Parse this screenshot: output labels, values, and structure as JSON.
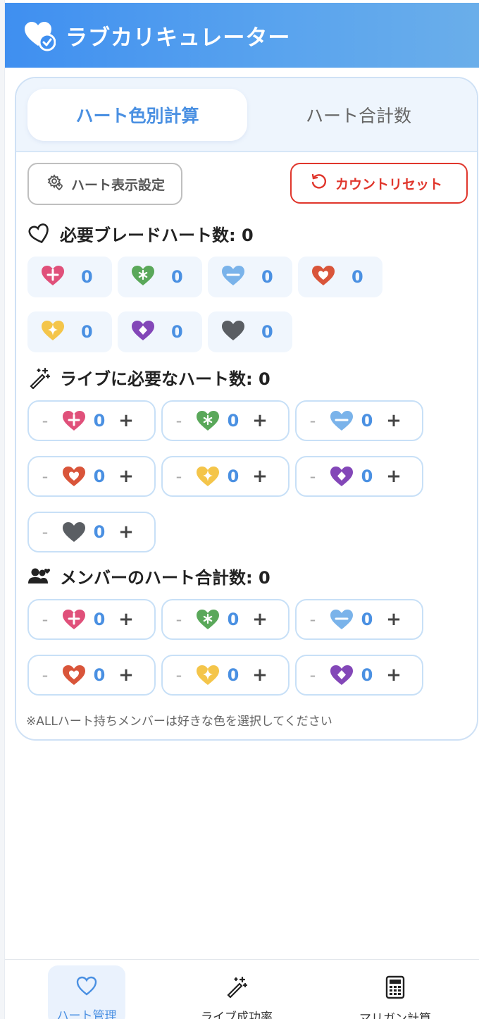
{
  "app": {
    "title": "ラブカリキュレーター"
  },
  "tabs": [
    {
      "label": "ハート色別計算",
      "active": true
    },
    {
      "label": "ハート合計数",
      "active": false
    }
  ],
  "buttons": {
    "settings_label": "ハート表示設定",
    "reset_label": "カウントリセット"
  },
  "colors": {
    "accent": "#4a90e2",
    "reset": "#e0362c",
    "pink": "#e0507a",
    "green": "#5aa85a",
    "blue": "#7ab3ea",
    "red": "#d9553a",
    "yellow": "#f4c54a",
    "purple": "#8347b8",
    "gray": "#5a5e63"
  },
  "blade_section": {
    "title": "必要ブレードハート数: 0",
    "items": [
      {
        "color": "pink",
        "icon": "plus-heart-icon",
        "value": "0"
      },
      {
        "color": "green",
        "icon": "asterisk-heart-icon",
        "value": "0"
      },
      {
        "color": "blue",
        "icon": "minus-heart-icon",
        "value": "0"
      },
      {
        "color": "red",
        "icon": "heart-in-heart-icon",
        "value": "0"
      },
      {
        "color": "yellow",
        "icon": "sparkle-heart-icon",
        "value": "0"
      },
      {
        "color": "purple",
        "icon": "diamond-heart-icon",
        "value": "0"
      },
      {
        "color": "gray",
        "icon": "plain-heart-icon",
        "value": "0"
      }
    ]
  },
  "live_section": {
    "title": "ライブに必要なハート数: 0",
    "items": [
      {
        "color": "pink",
        "icon": "plus-heart-icon",
        "value": "0"
      },
      {
        "color": "green",
        "icon": "asterisk-heart-icon",
        "value": "0"
      },
      {
        "color": "blue",
        "icon": "minus-heart-icon",
        "value": "0"
      },
      {
        "color": "red",
        "icon": "heart-in-heart-icon",
        "value": "0"
      },
      {
        "color": "yellow",
        "icon": "sparkle-heart-icon",
        "value": "0"
      },
      {
        "color": "purple",
        "icon": "diamond-heart-icon",
        "value": "0"
      },
      {
        "color": "gray",
        "icon": "plain-heart-icon",
        "value": "0"
      }
    ]
  },
  "member_section": {
    "title": "メンバーのハート合計数: 0",
    "items": [
      {
        "color": "pink",
        "icon": "plus-heart-icon",
        "value": "0"
      },
      {
        "color": "green",
        "icon": "asterisk-heart-icon",
        "value": "0"
      },
      {
        "color": "blue",
        "icon": "minus-heart-icon",
        "value": "0"
      },
      {
        "color": "red",
        "icon": "heart-in-heart-icon",
        "value": "0"
      },
      {
        "color": "yellow",
        "icon": "sparkle-heart-icon",
        "value": "0"
      },
      {
        "color": "purple",
        "icon": "diamond-heart-icon",
        "value": "0"
      }
    ]
  },
  "stepper": {
    "minus": "-",
    "plus": "+"
  },
  "note": "※ALLハート持ちメンバーは好きな色を選択してください",
  "bottom_nav": [
    {
      "label": "ハート管理",
      "icon": "heart-outline-icon",
      "active": true
    },
    {
      "label": "ライブ成功率",
      "icon": "magic-wand-icon",
      "active": false
    },
    {
      "label": "マリガン計算",
      "icon": "calculator-icon",
      "active": false
    }
  ]
}
